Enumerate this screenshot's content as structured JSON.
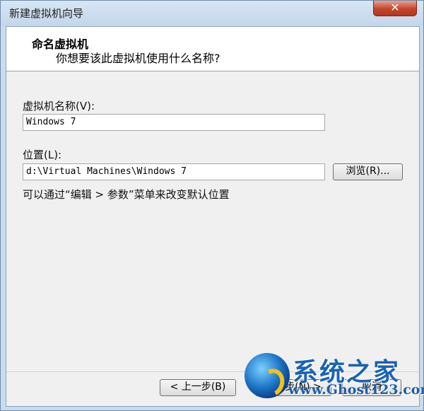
{
  "window": {
    "title": "新建虚拟机向导",
    "close_glyph": "✕"
  },
  "header": {
    "title": "命名虚拟机",
    "subtitle": "你想要该此虚拟机使用什么名称?"
  },
  "form": {
    "name_label": "虚拟机名称(V):",
    "name_value": "Windows 7",
    "location_label": "位置(L):",
    "location_value": "d:\\Virtual Machines\\Windows 7",
    "browse_label": "浏览(R)...",
    "hint": "可以通过“编辑 > 参数”菜单来改变默认位置"
  },
  "footer": {
    "back_label": "< 上一步(B)",
    "next_label": "下一步(N) >",
    "cancel_label": "取消"
  },
  "watermark": {
    "title": "系统之家",
    "url": "www.Ghost123.com"
  },
  "colors": {
    "titlebar": "#c9dcef",
    "close_button": "#c4442b",
    "dialog_bg": "#f0f0f0",
    "watermark_text": "#1b63b3"
  }
}
